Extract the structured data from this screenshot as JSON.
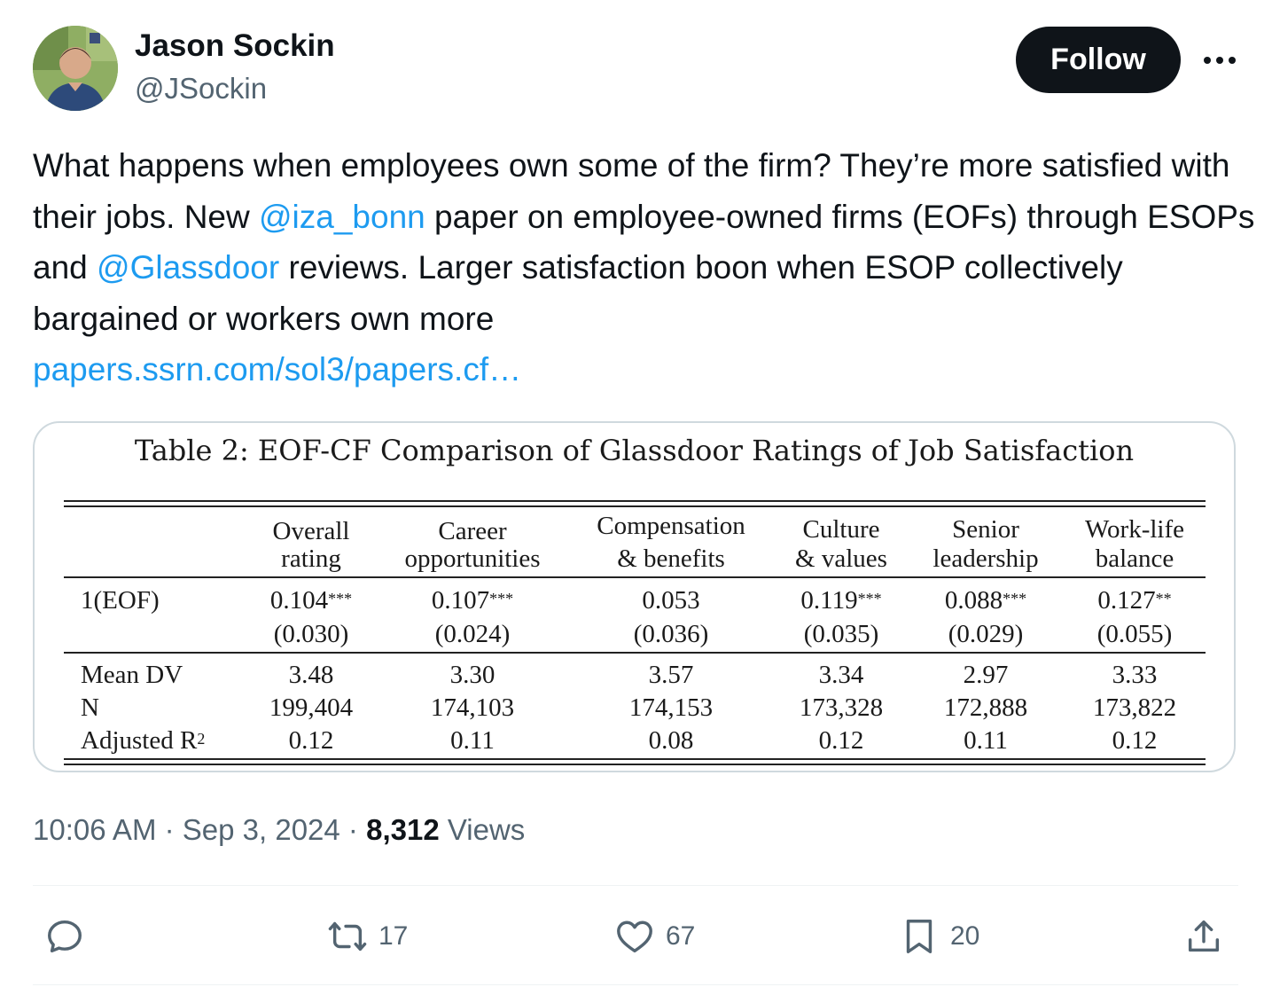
{
  "author": {
    "name": "Jason Sockin",
    "handle": "@JSockin",
    "follow_label": "Follow",
    "more_label": "More"
  },
  "tweet": {
    "text_1": "What happens when employees own some of the firm? They’re more satisfied with their jobs. New ",
    "mention_1": "@iza_bonn",
    "text_2": " paper on employee-owned firms (EOFs) through ESOPs and ",
    "mention_2": "@Glassdoor",
    "text_3": " reviews. Larger satisfaction boon when ESOP collectively bargained or workers own more",
    "link": "papers.ssrn.com/sol3/papers.cf…"
  },
  "table": {
    "caption": "Table 2: EOF-CF Comparison of Glassdoor Ratings of Job Satisfaction",
    "columns": [
      {
        "line1": "Overall",
        "line2": "rating"
      },
      {
        "line1": "Career",
        "line2": "opportunities"
      },
      {
        "line1": "Compensation",
        "line2": "& benefits"
      },
      {
        "line1": "Culture",
        "line2": "& values"
      },
      {
        "line1": "Senior",
        "line2": "leadership"
      },
      {
        "line1": "Work-life",
        "line2": "balance"
      }
    ],
    "eof_label": "1(EOF)",
    "eof_coef": [
      {
        "value": "0.104",
        "stars": "***"
      },
      {
        "value": "0.107",
        "stars": "***"
      },
      {
        "value": "0.053",
        "stars": ""
      },
      {
        "value": "0.119",
        "stars": "***"
      },
      {
        "value": "0.088",
        "stars": "***"
      },
      {
        "value": "0.127",
        "stars": "**"
      }
    ],
    "eof_se": [
      "(0.030)",
      "(0.024)",
      "(0.036)",
      "(0.035)",
      "(0.029)",
      "(0.055)"
    ],
    "mean_dv_label": "Mean DV",
    "mean_dv": [
      "3.48",
      "3.30",
      "3.57",
      "3.34",
      "2.97",
      "3.33"
    ],
    "n_label": "N",
    "n": [
      "199,404",
      "174,103",
      "174,153",
      "173,328",
      "172,888",
      "173,822"
    ],
    "r2_label": "Adjusted R",
    "r2_sup": "2",
    "r2": [
      "0.12",
      "0.11",
      "0.08",
      "0.12",
      "0.11",
      "0.12"
    ]
  },
  "meta": {
    "time": "10:06 AM",
    "date": "Sep 3, 2024",
    "views_count": "8,312",
    "views_label": "Views"
  },
  "actions": {
    "replies": "",
    "reposts": "17",
    "likes": "67",
    "bookmarks": "20"
  },
  "colors": {
    "link": "#1d9bf0",
    "text": "#0f1419",
    "secondary": "#536471",
    "follow_bg": "#0f1419"
  }
}
